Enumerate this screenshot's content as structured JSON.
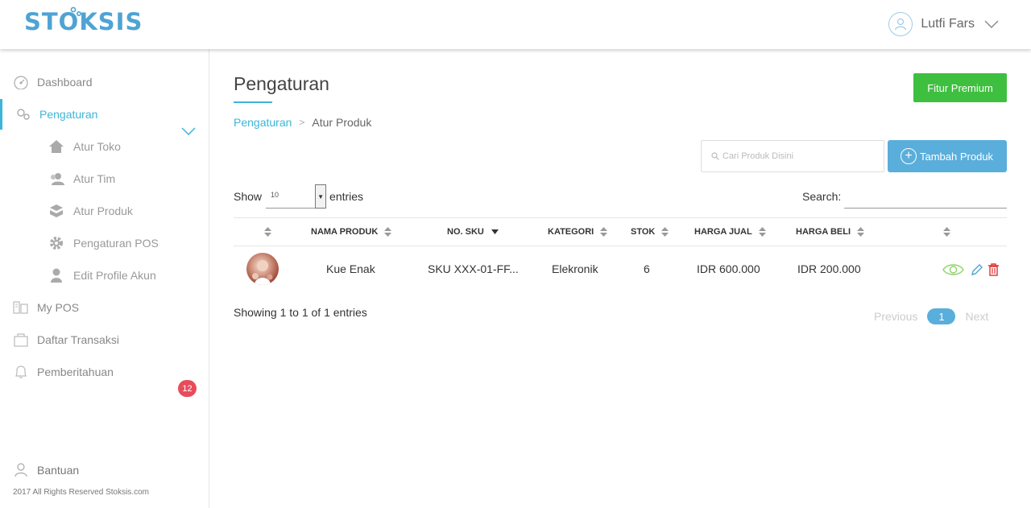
{
  "header": {
    "logo": "STOKSIS",
    "user_name": "Lutfi Fars",
    "icons": {
      "avatar": "user-circle-icon",
      "dropdown": "chevron-down-icon"
    }
  },
  "sidebar": {
    "items": [
      {
        "label": "Dashboard",
        "icon": "gauge-icon"
      },
      {
        "label": "Pengaturan",
        "icon": "gears-icon",
        "active": true
      },
      {
        "label": "My POS",
        "icon": "pos-icon"
      },
      {
        "label": "Daftar Transaksi",
        "icon": "bag-icon"
      },
      {
        "label": "Pemberitahuan",
        "icon": "bell-icon",
        "badge": "12"
      }
    ],
    "sub_items": [
      {
        "label": "Atur Toko",
        "icon": "home-icon"
      },
      {
        "label": "Atur Tim",
        "icon": "team-icon"
      },
      {
        "label": "Atur Produk",
        "icon": "box-icon"
      },
      {
        "label": "Pengaturan POS",
        "icon": "gear-icon"
      },
      {
        "label": "Edit Profile Akun",
        "icon": "person-icon"
      }
    ],
    "help": "Bantuan",
    "copyright": "2017 All Rights Reserved Stoksis.com"
  },
  "main": {
    "title": "Pengaturan",
    "premium_button": "Fitur Premium",
    "breadcrumb": {
      "parent": "Pengaturan",
      "separator": ">",
      "current": "Atur Produk"
    },
    "product_search_placeholder": "Cari Produk Disini",
    "add_button": "Tambah Produk",
    "show_label": "Show",
    "show_value": "10",
    "entries_label": "entries",
    "search_label": "Search:",
    "table": {
      "columns": [
        "",
        "NAMA PRODUK",
        "NO. SKU",
        "KATEGORI",
        "STOK",
        "HARGA JUAL",
        "HARGA BELI",
        ""
      ],
      "rows": [
        {
          "name": "Kue Enak",
          "sku": "SKU XXX-01-FF...",
          "category": "Elekronik",
          "stock": "6",
          "sell_price": "IDR 600.000",
          "buy_price": "IDR 200.000"
        }
      ]
    },
    "showing_text": "Showing 1 to 1 of 1 entries",
    "pagination": {
      "previous": "Previous",
      "current": "1",
      "next": "Next"
    }
  },
  "colors": {
    "accent": "#3db5d8",
    "premium": "#3fbf3f",
    "primary_button": "#5aaedb",
    "badge": "#e84c5a"
  }
}
